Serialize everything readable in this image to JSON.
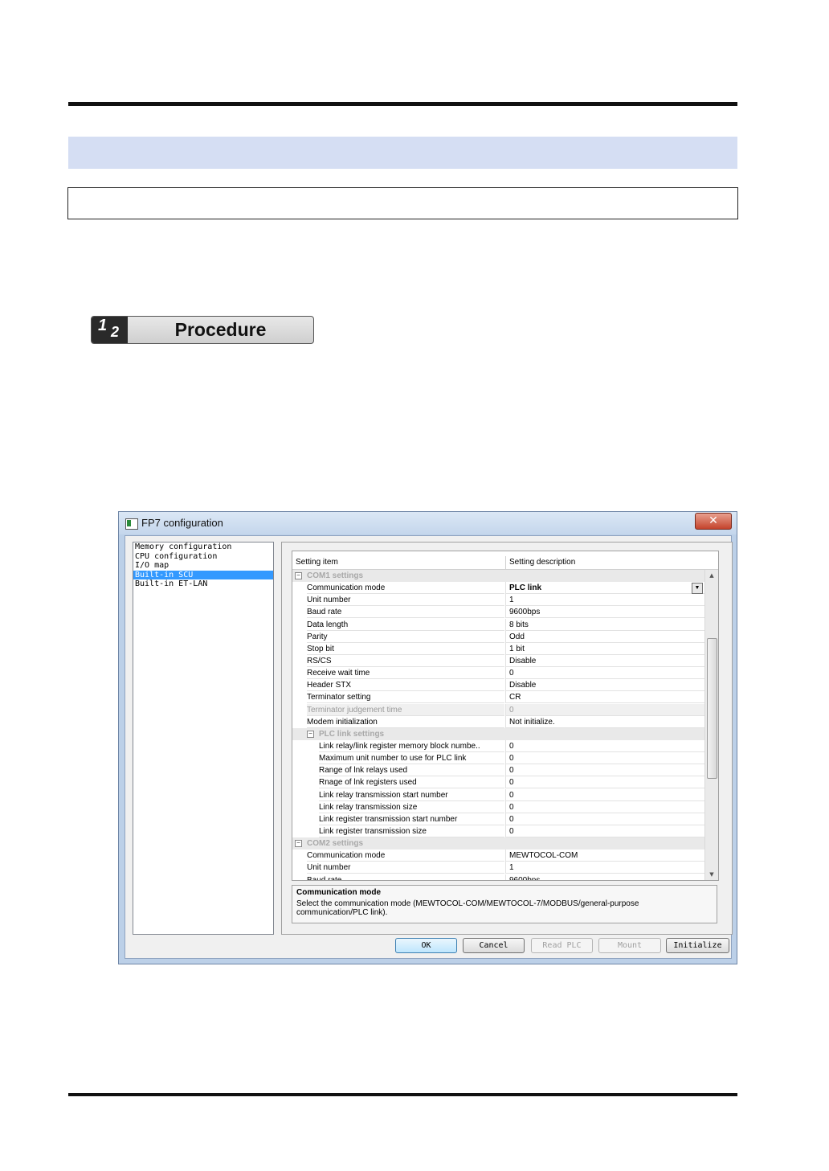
{
  "procedure": {
    "num1": "1",
    "num2": "2",
    "label": "Procedure"
  },
  "window": {
    "title": "FP7 configuration",
    "close_glyph": "✕",
    "tree": {
      "items": [
        {
          "label": "Memory configuration",
          "selected": false
        },
        {
          "label": "CPU configuration",
          "selected": false
        },
        {
          "label": "I/O map",
          "selected": false
        },
        {
          "label": "Built-in SCU",
          "selected": true
        },
        {
          "label": "Built-in ET-LAN",
          "selected": false
        }
      ]
    },
    "grid": {
      "header": {
        "item": "Setting item",
        "desc": "Setting description"
      },
      "rows": [
        {
          "type": "cat",
          "label": "COM1 settings",
          "indent": false
        },
        {
          "item": "Communication mode",
          "value": "PLC link",
          "selected": true,
          "dropdown": true
        },
        {
          "item": "Unit number",
          "value": "1"
        },
        {
          "item": "Baud rate",
          "value": "9600bps"
        },
        {
          "item": "Data length",
          "value": "8 bits"
        },
        {
          "item": "Parity",
          "value": "Odd"
        },
        {
          "item": "Stop bit",
          "value": "1 bit"
        },
        {
          "item": "RS/CS",
          "value": "Disable"
        },
        {
          "item": "Receive wait time",
          "value": "0"
        },
        {
          "item": "Header STX",
          "value": "Disable"
        },
        {
          "item": "Terminator setting",
          "value": "CR"
        },
        {
          "item": "Terminator judgement time",
          "value": "0",
          "disabled": true
        },
        {
          "item": "Modem initialization",
          "value": "Not initialize."
        },
        {
          "type": "cat",
          "label": "PLC link settings",
          "indent": true
        },
        {
          "item": "Link relay/link register memory block numbe..",
          "value": "0",
          "indent": true
        },
        {
          "item": "Maximum unit number to use for PLC link",
          "value": "0",
          "indent": true
        },
        {
          "item": "Range of lnk relays used",
          "value": "0",
          "indent": true
        },
        {
          "item": "Rnage of lnk registers used",
          "value": "0",
          "indent": true
        },
        {
          "item": "Link relay transmission start number",
          "value": "0",
          "indent": true
        },
        {
          "item": "Link relay transmission size",
          "value": "0",
          "indent": true
        },
        {
          "item": "Link register transmission start number",
          "value": "0",
          "indent": true
        },
        {
          "item": "Link register transmission size",
          "value": "0",
          "indent": true
        },
        {
          "type": "cat",
          "label": "COM2 settings",
          "indent": false
        },
        {
          "item": "Communication mode",
          "value": "MEWTOCOL-COM"
        },
        {
          "item": "Unit number",
          "value": "1"
        },
        {
          "item": "Baud rate",
          "value": "9600bps"
        }
      ]
    },
    "description": {
      "title": "Communication mode",
      "text": "Select the communication mode (MEWTOCOL-COM/MEWTOCOL-7/MODBUS/general-purpose communication/PLC link)."
    },
    "buttons": {
      "ok": "OK",
      "cancel": "Cancel",
      "read_plc": "Read PLC",
      "mount": "Mount",
      "initialize": "Initialize"
    }
  }
}
